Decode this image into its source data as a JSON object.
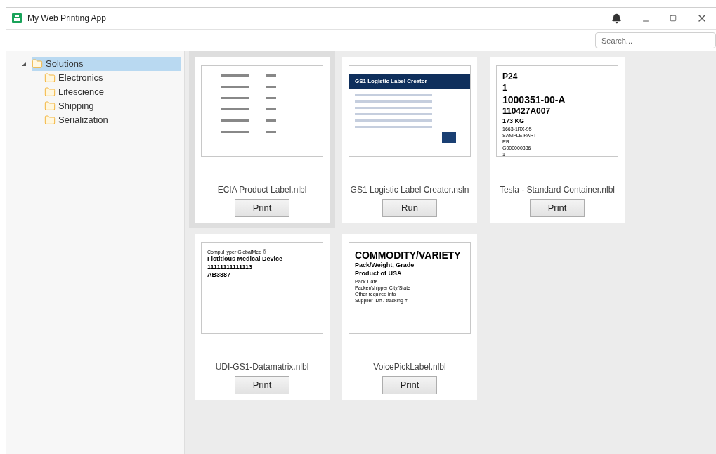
{
  "window": {
    "title": "My Web Printing App"
  },
  "search": {
    "placeholder": "Search..."
  },
  "tree": {
    "label": "Solutions",
    "expanded": true,
    "selected": true,
    "children": [
      {
        "label": "Electronics",
        "selected": false
      },
      {
        "label": "Lifescience",
        "selected": false
      },
      {
        "label": "Shipping",
        "selected": false
      },
      {
        "label": "Serialization",
        "selected": false
      }
    ]
  },
  "cards": [
    {
      "name": "ECIA Product Label.nlbl",
      "action": "Print",
      "selected": true,
      "preview": {
        "kind": "form"
      }
    },
    {
      "name": "GS1 Logistic Label Creator.nsln",
      "action": "Run",
      "selected": false,
      "preview": {
        "kind": "app",
        "lines": [
          {
            "kind": "banner",
            "text": "GS1 Logistic Label Creator"
          }
        ]
      }
    },
    {
      "name": "Tesla - Standard Container.nlbl",
      "action": "Print",
      "selected": false,
      "preview": {
        "kind": "label",
        "lines": [
          {
            "kind": "large",
            "text": "P24"
          },
          {
            "kind": "large",
            "text": "1"
          },
          {
            "kind": "huge",
            "text": "1000351-00-A"
          },
          {
            "kind": "large",
            "text": "110427A007"
          },
          {
            "kind": "medium",
            "text": "173 KG"
          },
          {
            "kind": "small",
            "text": "1663-1RX-95"
          },
          {
            "kind": "small",
            "text": "SAMPLE PART"
          },
          {
            "kind": "small",
            "text": "RR"
          },
          {
            "kind": "small",
            "text": "G000000336"
          },
          {
            "kind": "small",
            "text": "1"
          }
        ]
      }
    },
    {
      "name": "UDI-GS1-Datamatrix.nlbl",
      "action": "Print",
      "selected": false,
      "preview": {
        "kind": "label",
        "lines": [
          {
            "kind": "small",
            "text": "CompuHyper GlobalMed ®"
          },
          {
            "kind": "medium",
            "text": "Fictitious Medical Device"
          },
          {
            "kind": "medium",
            "text": "11111111111113"
          },
          {
            "kind": "medium",
            "text": "AB3887"
          }
        ]
      }
    },
    {
      "name": "VoicePickLabel.nlbl",
      "action": "Print",
      "selected": false,
      "preview": {
        "kind": "label",
        "lines": [
          {
            "kind": "huge",
            "text": "COMMODITY/VARIETY"
          },
          {
            "kind": "medium",
            "text": "Pack/Weight, Grade"
          },
          {
            "kind": "medium",
            "text": "Product of USA"
          },
          {
            "kind": "small",
            "text": "Pack Date"
          },
          {
            "kind": "small",
            "text": "Packer/shipper  City/State"
          },
          {
            "kind": "small",
            "text": "Other required info"
          },
          {
            "kind": "small",
            "text": "Supplier ID# / tracking #"
          }
        ]
      }
    }
  ]
}
